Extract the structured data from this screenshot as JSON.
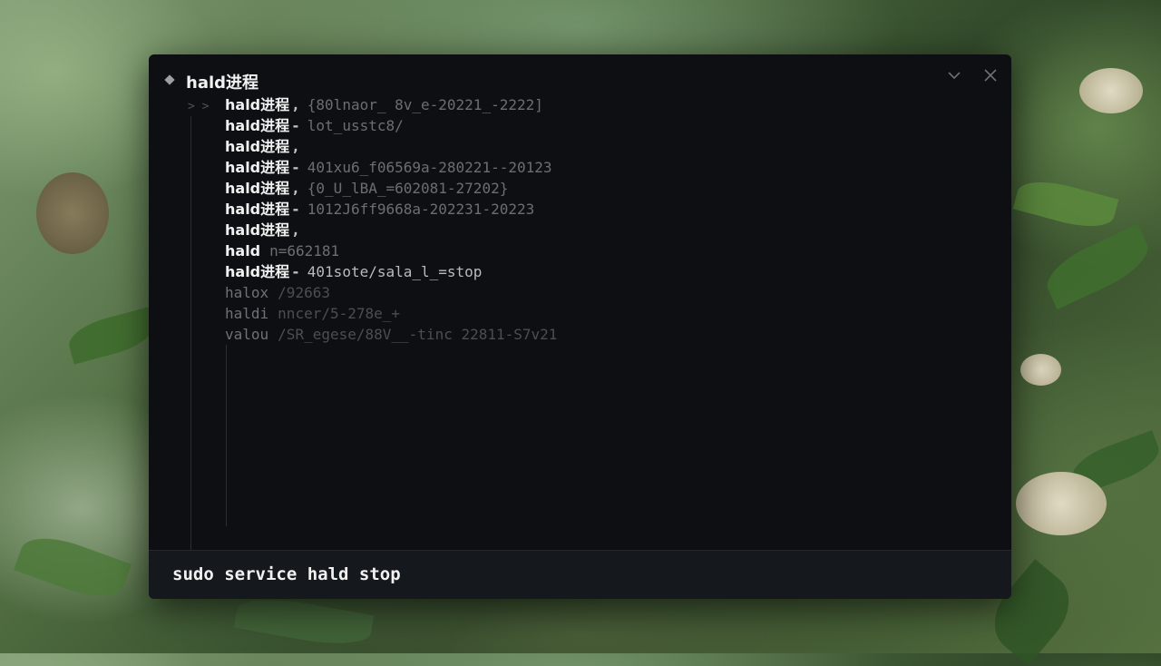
{
  "panel": {
    "title": "hald进程",
    "collapse_icon": "chevron-down-icon",
    "close_icon": "close-icon",
    "expander_glyphs": "> >"
  },
  "tree_rows": [
    {
      "label": "hald进程",
      "sep": ",",
      "detail": "{80lnaor̲ 8v̲e-20221̲-2222]"
    },
    {
      "label": "hald进程",
      "sep": "-",
      "detail": "lot_usstc8/"
    },
    {
      "label": "hald进程",
      "sep": ",",
      "detail": ""
    },
    {
      "label": "hald进程",
      "sep": "-",
      "detail": "401xu6̲f06569a-280221--20123"
    },
    {
      "label": "hald进程",
      "sep": ",",
      "detail": "{0̲U̲lBA̲=602081-27202}"
    },
    {
      "label": "hald进程",
      "sep": "-",
      "detail": "1012J6ff9668a-202231-20223"
    },
    {
      "label": "hald进程",
      "sep": ",",
      "detail": ""
    },
    {
      "label": "hald",
      "sep": "",
      "detail": "n=662181"
    },
    {
      "label": "hald进程",
      "sep": "-",
      "detail": "401sote/sala̲l̲=stop"
    },
    {
      "label": "halox",
      "sep": "",
      "detail": "/92663"
    },
    {
      "label": "haldi",
      "sep": "",
      "detail": "nncer/5-278e̲+"
    },
    {
      "label": "valou",
      "sep": "",
      "detail": "/SR̲egese/88V̲̲-tinc 22811-S7v21"
    }
  ],
  "input": {
    "value": "sudo service hald stop"
  }
}
